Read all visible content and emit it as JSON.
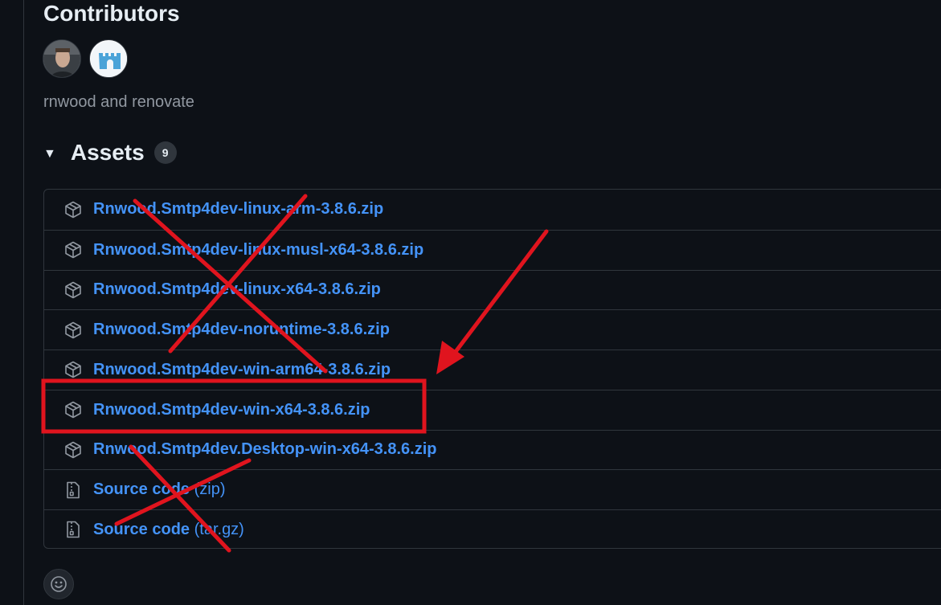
{
  "contributors": {
    "title": "Contributors",
    "avatars": [
      {
        "icon": "user-photo-avatar"
      },
      {
        "icon": "bot-castle-avatar",
        "color": "#4aa3d8"
      }
    ],
    "names": "rnwood and renovate"
  },
  "assets": {
    "title": "Assets",
    "count": "9",
    "items": [
      {
        "label": "Rnwood.Smtp4dev-linux-arm-3.8.6.zip",
        "icon": "package-icon",
        "crossed_out": true
      },
      {
        "label": "Rnwood.Smtp4dev-linux-musl-x64-3.8.6.zip",
        "icon": "package-icon",
        "crossed_out": true
      },
      {
        "label": "Rnwood.Smtp4dev-linux-x64-3.8.6.zip",
        "icon": "package-icon",
        "crossed_out": true
      },
      {
        "label": "Rnwood.Smtp4dev-noruntime-3.8.6.zip",
        "icon": "package-icon",
        "crossed_out": true
      },
      {
        "label": "Rnwood.Smtp4dev-win-arm64-3.8.6.zip",
        "icon": "package-icon",
        "crossed_out": true
      },
      {
        "label": "Rnwood.Smtp4dev-win-x64-3.8.6.zip",
        "icon": "package-icon",
        "highlighted": true
      },
      {
        "label": "Rnwood.Smtp4dev.Desktop-win-x64-3.8.6.zip",
        "icon": "package-icon"
      },
      {
        "label": "Source code",
        "suffix": "(zip)",
        "icon": "file-zip-icon",
        "crossed_out": true
      },
      {
        "label": "Source code",
        "suffix": "(tar.gz)",
        "icon": "file-zip-icon",
        "crossed_out": true
      }
    ]
  },
  "reactions": {
    "icon": "smiley-icon"
  },
  "annotations": {
    "color": "#e0141e"
  }
}
